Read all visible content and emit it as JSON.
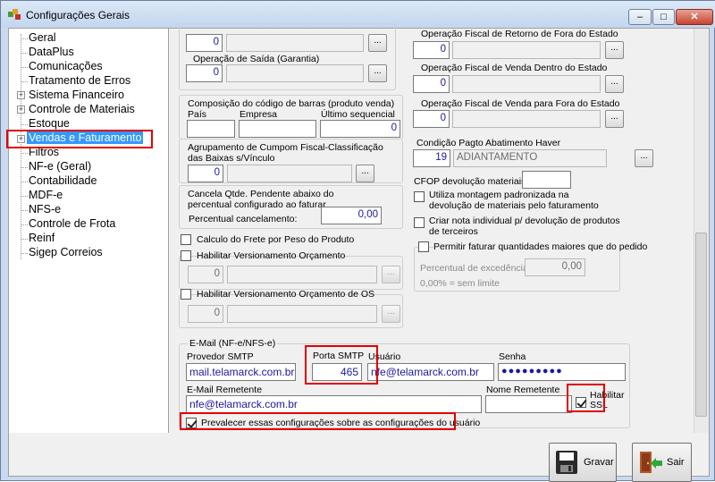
{
  "window": {
    "title": "Configurações Gerais"
  },
  "tree": {
    "items": [
      "Geral",
      "DataPlus",
      "Comunicações",
      "Tratamento de Erros",
      "Sistema Financeiro",
      "Controle de Materiais",
      "Estoque",
      "Vendas e Faturamento",
      "Filtros",
      "NF-e (Geral)",
      "Contabilidade",
      "MDF-e",
      "NFS-e",
      "Controle de Frota",
      "Reinf",
      "Sigep Correios"
    ]
  },
  "left": {
    "top_value": "0",
    "saida_garantia": {
      "label": "Operação de Saída (Garantia)",
      "value": "0"
    },
    "barcode": {
      "title": "Composição do código de barras (produto venda)",
      "pais_label": "País",
      "empresa_label": "Empresa",
      "ultimo_label": "Último sequencial",
      "ultimo_value": "0"
    },
    "agrupamento": {
      "label": "Agrupamento de Cumpom Fiscal-Classificação das Baixas s/Vínculo",
      "value": "0"
    },
    "cancela": {
      "label": "Cancela Qtde. Pendente abaixo do percentual configurado ao faturar",
      "perc_label": "Percentual cancelamento:",
      "perc_value": "0,00"
    },
    "frete_label": "Calculo do Frete por Peso do Produto",
    "vers_orc": {
      "label": "Habilitar Versionamento Orçamento",
      "value": "0"
    },
    "vers_os": {
      "label": "Habilitar Versionamento Orçamento de OS",
      "value": "0"
    }
  },
  "right": {
    "retorno_fora": {
      "label": "Operação Fiscal de Retorno de Fora do Estado",
      "value": "0"
    },
    "venda_dentro": {
      "label": "Operação Fiscal de Venda Dentro do Estado",
      "value": "0"
    },
    "venda_fora": {
      "label": "Operação Fiscal de Venda para Fora do Estado",
      "value": "0"
    },
    "cond_pagto": {
      "label": "Condição Pagto Abatimento Haver",
      "code": "19",
      "desc": "ADIANTAMENTO"
    },
    "cfop_label": "CFOP devolução materiais:",
    "utiliza_label": "Utiliza montagem padronizada na devolução de materiais pelo faturamento",
    "criar_nota_label": "Criar nota individual p/ devolução de produtos de terceiros",
    "permitir_label": "Permitir faturar quantidades maiores que do pedido",
    "excedencia_label": "Percentual de excedência:",
    "excedencia_value": "0,00",
    "sem_limite": "0,00% = sem limite"
  },
  "email": {
    "group_label": "E-Mail (NF-e/NFS-e)",
    "provedor_label": "Provedor SMTP",
    "provedor_value": "mail.telamarck.com.br",
    "porta_label": "Porta SMTP",
    "porta_value": "465",
    "usuario_label": "Usuário",
    "usuario_value": "nfe@telamarck.com.br",
    "senha_label": "Senha",
    "senha_value": "●●●●●●●●●",
    "remetente_label": "E-Mail Remetente",
    "remetente_value": "nfe@telamarck.com.br",
    "nome_rem_label": "Nome Remetente",
    "ssl_label_1": "Habilitar",
    "ssl_label_2": "SSL",
    "prevalecer_label": "Prevalecer essas configurações sobre as configurações do usuário"
  },
  "buttons": {
    "gravar": "Gravar",
    "sair": "Sair"
  },
  "window_controls": {
    "min": "–",
    "max": "□",
    "close": "✕"
  },
  "dots": "...",
  "colors": {
    "highlight_red": "#e00000",
    "selection_blue": "#3399ff",
    "value_blue": "#1a1aa0"
  }
}
